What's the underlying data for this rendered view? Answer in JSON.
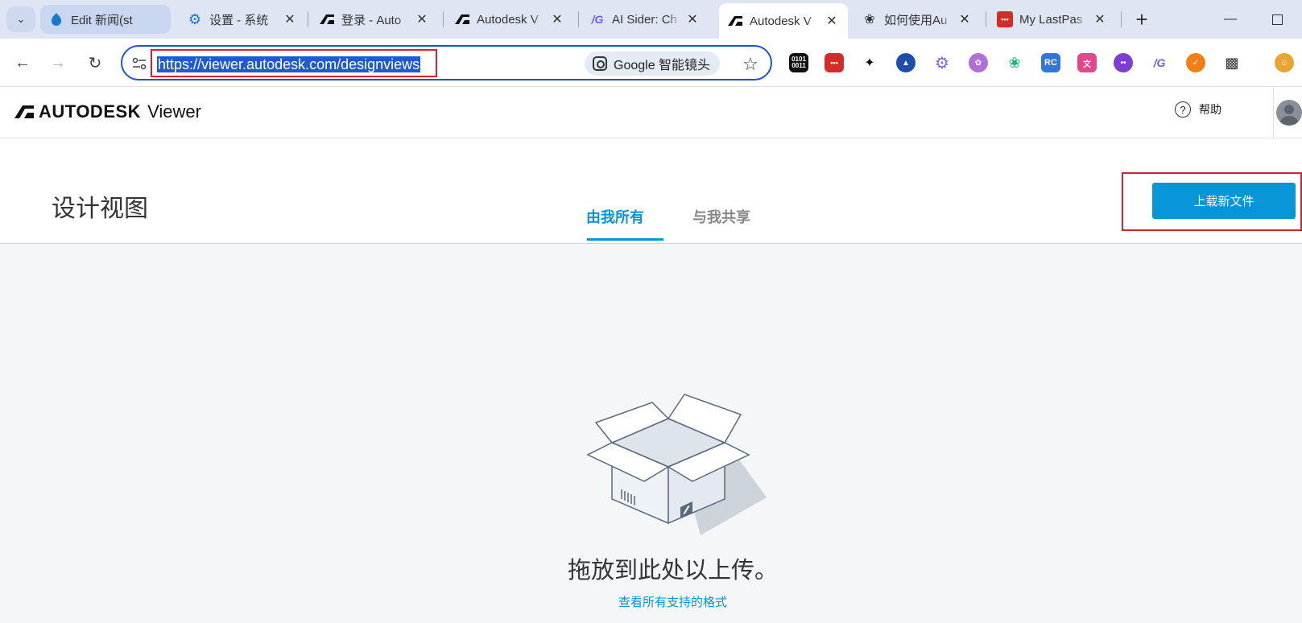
{
  "browser": {
    "tabs": [
      {
        "label": "Edit 新闻(st",
        "icon": "drupal-icon"
      },
      {
        "label": "设置 - 系统",
        "icon": "gear-icon"
      },
      {
        "label": "登录 - Auto",
        "icon": "autodesk-icon"
      },
      {
        "label": "Autodesk V",
        "icon": "autodesk-icon"
      },
      {
        "label": "AI Sider: Ch",
        "icon": "sider-icon"
      },
      {
        "label": "Autodesk V",
        "icon": "autodesk-icon",
        "active": true
      },
      {
        "label": "如何使用Au",
        "icon": "openai-icon"
      },
      {
        "label": "My LastPas",
        "icon": "lastpass-icon"
      }
    ],
    "url": "https://viewer.autodesk.com/designviews",
    "lens_label": "Google 智能镜头",
    "extensions": [
      "binary-icon",
      "lastpass-icon",
      "sparkle-icon",
      "triangle-icon",
      "gear-purple-icon",
      "brain-icon",
      "leaf-icon",
      "rc-icon",
      "translate-icon",
      "robot-icon",
      "sider-icon",
      "orange-icon",
      "puzzle-icon",
      "profile-icon"
    ],
    "extension_texts": {
      "binary": "0101\n0011",
      "rc": "RC"
    }
  },
  "app": {
    "logo_text": "AUTODESK",
    "logo_sub": "Viewer",
    "help_label": "帮助"
  },
  "page": {
    "title": "设计视图",
    "tabs": {
      "owned": "由我所有",
      "shared": "与我共享"
    },
    "upload_label": "上载新文件",
    "drop_text": "拖放到此处以上传。",
    "formats_link": "查看所有支持的格式"
  },
  "colors": {
    "accent": "#0696d7",
    "highlight": "#d6242f",
    "url_selection": "#1f5ad2"
  }
}
